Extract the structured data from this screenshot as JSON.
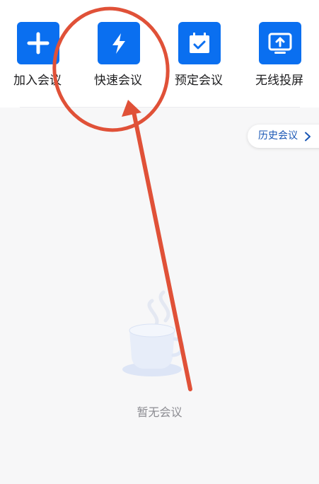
{
  "actions": [
    {
      "label": "加入会议",
      "icon": "plus-icon"
    },
    {
      "label": "快速会议",
      "icon": "lightning-icon"
    },
    {
      "label": "预定会议",
      "icon": "calendar-check-icon"
    },
    {
      "label": "无线投屏",
      "icon": "screen-cast-icon"
    }
  ],
  "history": {
    "label": "历史会议",
    "icon": "chevron-right-icon"
  },
  "empty_state": {
    "text": "暂无会议",
    "icon": "coffee-cup-icon"
  },
  "annotation": {
    "circle": "red-circle-annotation",
    "arrow": "red-arrow-annotation"
  },
  "colors": {
    "accent": "#0a6ff0",
    "history_text": "#1a57b5",
    "annotation": "#e05138",
    "background": "#f7f7f8"
  }
}
